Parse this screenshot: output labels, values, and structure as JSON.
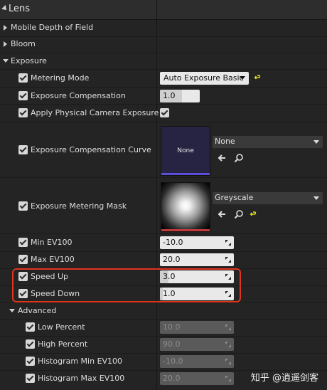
{
  "header": {
    "title": "Lens"
  },
  "sections": {
    "mobile_dof": "Mobile Depth of Field",
    "bloom": "Bloom",
    "exposure": "Exposure",
    "advanced": "Advanced"
  },
  "properties": {
    "metering_mode": {
      "label": "Metering Mode",
      "value": "Auto Exposure Basic"
    },
    "exposure_compensation": {
      "label": "Exposure Compensation",
      "value": "1.0",
      "fill_fraction": 0.55
    },
    "apply_physical": {
      "label": "Apply Physical Camera Exposure",
      "checked": true
    },
    "exposure_curve": {
      "label": "Exposure Compensation Curve",
      "asset": "None",
      "thumb_text": "None"
    },
    "metering_mask": {
      "label": "Exposure Metering Mask",
      "asset": "Greyscale"
    },
    "min_ev100": {
      "label": "Min EV100",
      "value": "-10.0"
    },
    "max_ev100": {
      "label": "Max EV100",
      "value": "20.0"
    },
    "speed_up": {
      "label": "Speed Up",
      "value": "3.0",
      "fill_fraction": 0.12
    },
    "speed_down": {
      "label": "Speed Down",
      "value": "1.0",
      "fill_fraction": 0.04
    },
    "low_percent": {
      "label": "Low Percent",
      "value": "10.0"
    },
    "high_percent": {
      "label": "High Percent",
      "value": "90.0"
    },
    "histogram_min": {
      "label": "Histogram Min EV100",
      "value": "-10.0"
    },
    "histogram_max": {
      "label": "Histogram Max EV100",
      "value": "20.0"
    }
  },
  "watermark": "知乎 @逍遥剑客",
  "colors": {
    "background": "#242424",
    "highlight": "#e0351c",
    "reset_icon": "#e0e020"
  }
}
